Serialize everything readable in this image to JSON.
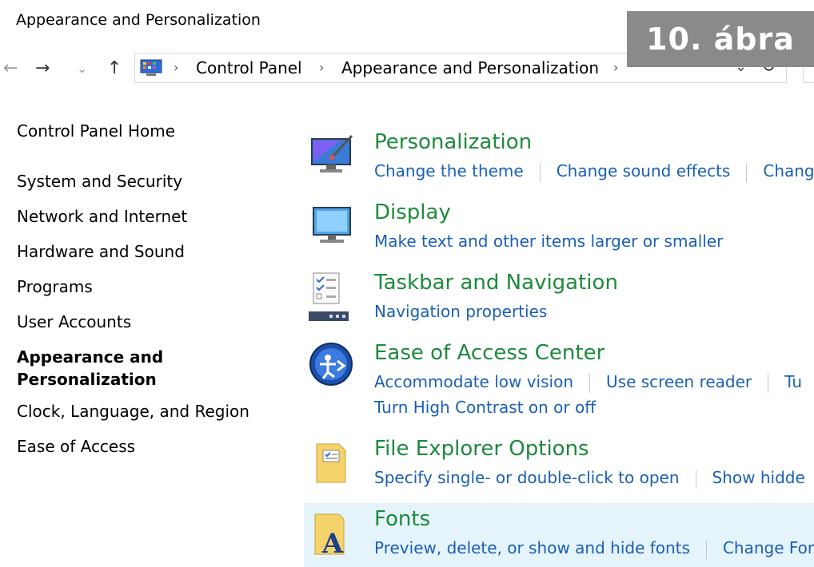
{
  "window": {
    "title": "Appearance and Personalization"
  },
  "badge": {
    "text": "10. ábra"
  },
  "nav": {
    "back": "←",
    "forward": "→",
    "recent": "⌄",
    "up": "↑",
    "breadcrumb": [
      "Control Panel",
      "Appearance and Personalization"
    ],
    "separator": "›",
    "dropdown": "⌄",
    "refresh": "↻"
  },
  "sidebar": {
    "home": "Control Panel Home",
    "items": [
      "System and Security",
      "Network and Internet",
      "Hardware and Sound",
      "Programs",
      "User Accounts",
      "Appearance and Personalization",
      "Clock, Language, and Region",
      "Ease of Access"
    ],
    "active": "Appearance and Personalization"
  },
  "categories": [
    {
      "title": "Personalization",
      "icon": "personalization-icon",
      "links": [
        "Change the theme",
        "Change sound effects",
        "Chang"
      ]
    },
    {
      "title": "Display",
      "icon": "display-icon",
      "links": [
        "Make text and other items larger or smaller"
      ]
    },
    {
      "title": "Taskbar and Navigation",
      "icon": "taskbar-icon",
      "links": [
        "Navigation properties"
      ]
    },
    {
      "title": "Ease of Access Center",
      "icon": "ease-of-access-icon",
      "links": [
        "Accommodate low vision",
        "Use screen reader",
        "Tu",
        "Turn High Contrast on or off"
      ]
    },
    {
      "title": "File Explorer Options",
      "icon": "folder-options-icon",
      "links": [
        "Specify single- or double-click to open",
        "Show hidde"
      ]
    },
    {
      "title": "Fonts",
      "icon": "fonts-icon",
      "links": [
        "Preview, delete, or show and hide fonts",
        "Change For"
      ]
    }
  ],
  "colors": {
    "category_title": "#1e8a3c",
    "link": "#1a5fb4",
    "highlight": "#e5f3fb",
    "badge_bg": "#8a8a8a"
  }
}
